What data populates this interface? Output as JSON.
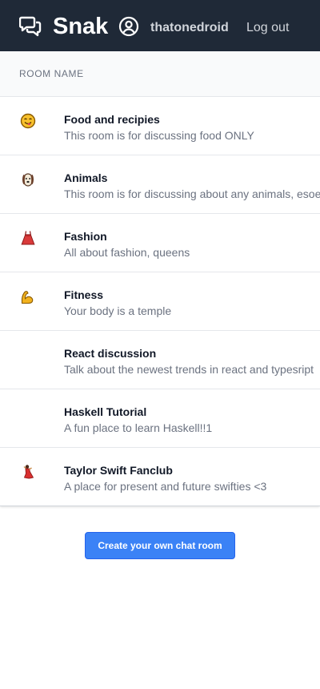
{
  "header": {
    "logo_icon": "chat-bubbles-icon",
    "title": "Snak",
    "user_icon": "user-circle-icon",
    "username": "thatonedroid",
    "logout_label": "Log out"
  },
  "table": {
    "column_header": "ROOM NAME",
    "rooms": [
      {
        "icon": "smiling-face-icon",
        "name": "Food and recipies",
        "description": "This room is for discussing food ONLY"
      },
      {
        "icon": "dog-face-icon",
        "name": "Animals",
        "description": "This room is for discussing about any animals, esoec"
      },
      {
        "icon": "dress-icon",
        "name": "Fashion",
        "description": "All about fashion, queens"
      },
      {
        "icon": "flexed-biceps-icon",
        "name": "Fitness",
        "description": "Your body is a temple"
      },
      {
        "icon": "",
        "name": "React discussion",
        "description": "Talk about the newest trends in react and typesript"
      },
      {
        "icon": "",
        "name": "Haskell Tutorial",
        "description": "A fun place to learn Haskell!!1"
      },
      {
        "icon": "dancer-icon",
        "name": "Taylor Swift Fanclub",
        "description": "A place for present and future swifties <3"
      }
    ]
  },
  "create_button_label": "Create your own chat room",
  "colors": {
    "navbar": "#1f2937",
    "button": "#3b82f6",
    "header_row": "#f9fafb"
  }
}
